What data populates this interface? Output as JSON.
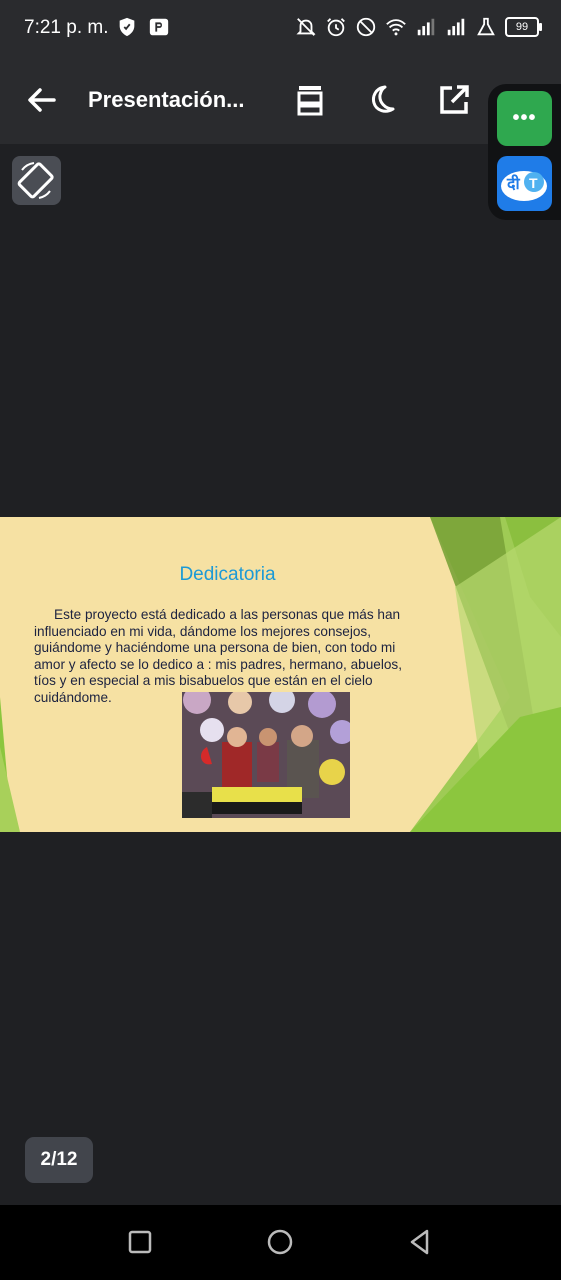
{
  "status_bar": {
    "time": "7:21 p. m.",
    "battery": "99",
    "icons_left": [
      "shield-icon",
      "app-p-icon"
    ],
    "icons_right": [
      "bell-off-icon",
      "alarm-icon",
      "do-not-disturb-icon",
      "wifi-icon",
      "signal-icon",
      "signal-icon",
      "lab-icon",
      "battery-icon"
    ]
  },
  "toolbar": {
    "title": "Presentación...",
    "buttons": [
      "back-arrow-icon",
      "page-layout-icon",
      "dark-mode-moon-icon",
      "open-external-icon"
    ]
  },
  "floating_apps": {
    "apps": [
      "more-dots-app",
      "translate-app"
    ],
    "translate_label": "दी T",
    "dots_label": "•••"
  },
  "slide": {
    "title": "Dedicatoria",
    "body": "Este proyecto está dedicado a las personas que más han influenciado en mi vida, dándome los mejores consejos, guiándome y haciéndome una persona de bien, con todo mi amor y afecto se lo dedico a : mis padres, hermano, abuelos, tíos y en especial a mis bisabuelos que están en el cielo cuidándome.",
    "colors": {
      "background": "#f6e1a3",
      "title": "#1c9ad6",
      "accent_green": "#8cc63e"
    }
  },
  "page_indicator": "2/12",
  "nav_bar": [
    "recents-square-icon",
    "home-circle-icon",
    "back-triangle-icon"
  ]
}
